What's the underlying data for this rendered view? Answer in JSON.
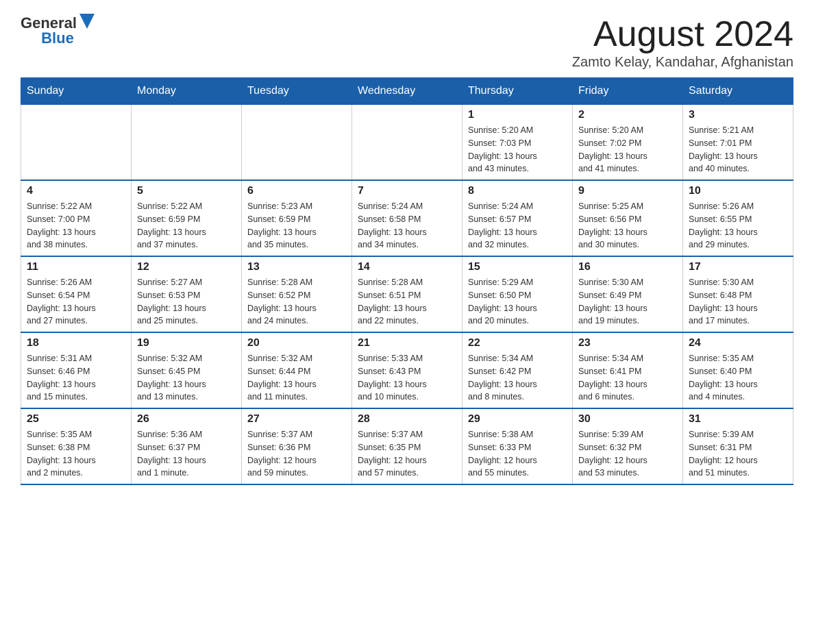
{
  "header": {
    "logo": {
      "general": "General",
      "blue": "Blue"
    },
    "month_title": "August 2024",
    "location": "Zamto Kelay, Kandahar, Afghanistan"
  },
  "days_of_week": [
    "Sunday",
    "Monday",
    "Tuesday",
    "Wednesday",
    "Thursday",
    "Friday",
    "Saturday"
  ],
  "weeks": [
    {
      "days": [
        {
          "number": "",
          "info": ""
        },
        {
          "number": "",
          "info": ""
        },
        {
          "number": "",
          "info": ""
        },
        {
          "number": "",
          "info": ""
        },
        {
          "number": "1",
          "info": "Sunrise: 5:20 AM\nSunset: 7:03 PM\nDaylight: 13 hours\nand 43 minutes."
        },
        {
          "number": "2",
          "info": "Sunrise: 5:20 AM\nSunset: 7:02 PM\nDaylight: 13 hours\nand 41 minutes."
        },
        {
          "number": "3",
          "info": "Sunrise: 5:21 AM\nSunset: 7:01 PM\nDaylight: 13 hours\nand 40 minutes."
        }
      ]
    },
    {
      "days": [
        {
          "number": "4",
          "info": "Sunrise: 5:22 AM\nSunset: 7:00 PM\nDaylight: 13 hours\nand 38 minutes."
        },
        {
          "number": "5",
          "info": "Sunrise: 5:22 AM\nSunset: 6:59 PM\nDaylight: 13 hours\nand 37 minutes."
        },
        {
          "number": "6",
          "info": "Sunrise: 5:23 AM\nSunset: 6:59 PM\nDaylight: 13 hours\nand 35 minutes."
        },
        {
          "number": "7",
          "info": "Sunrise: 5:24 AM\nSunset: 6:58 PM\nDaylight: 13 hours\nand 34 minutes."
        },
        {
          "number": "8",
          "info": "Sunrise: 5:24 AM\nSunset: 6:57 PM\nDaylight: 13 hours\nand 32 minutes."
        },
        {
          "number": "9",
          "info": "Sunrise: 5:25 AM\nSunset: 6:56 PM\nDaylight: 13 hours\nand 30 minutes."
        },
        {
          "number": "10",
          "info": "Sunrise: 5:26 AM\nSunset: 6:55 PM\nDaylight: 13 hours\nand 29 minutes."
        }
      ]
    },
    {
      "days": [
        {
          "number": "11",
          "info": "Sunrise: 5:26 AM\nSunset: 6:54 PM\nDaylight: 13 hours\nand 27 minutes."
        },
        {
          "number": "12",
          "info": "Sunrise: 5:27 AM\nSunset: 6:53 PM\nDaylight: 13 hours\nand 25 minutes."
        },
        {
          "number": "13",
          "info": "Sunrise: 5:28 AM\nSunset: 6:52 PM\nDaylight: 13 hours\nand 24 minutes."
        },
        {
          "number": "14",
          "info": "Sunrise: 5:28 AM\nSunset: 6:51 PM\nDaylight: 13 hours\nand 22 minutes."
        },
        {
          "number": "15",
          "info": "Sunrise: 5:29 AM\nSunset: 6:50 PM\nDaylight: 13 hours\nand 20 minutes."
        },
        {
          "number": "16",
          "info": "Sunrise: 5:30 AM\nSunset: 6:49 PM\nDaylight: 13 hours\nand 19 minutes."
        },
        {
          "number": "17",
          "info": "Sunrise: 5:30 AM\nSunset: 6:48 PM\nDaylight: 13 hours\nand 17 minutes."
        }
      ]
    },
    {
      "days": [
        {
          "number": "18",
          "info": "Sunrise: 5:31 AM\nSunset: 6:46 PM\nDaylight: 13 hours\nand 15 minutes."
        },
        {
          "number": "19",
          "info": "Sunrise: 5:32 AM\nSunset: 6:45 PM\nDaylight: 13 hours\nand 13 minutes."
        },
        {
          "number": "20",
          "info": "Sunrise: 5:32 AM\nSunset: 6:44 PM\nDaylight: 13 hours\nand 11 minutes."
        },
        {
          "number": "21",
          "info": "Sunrise: 5:33 AM\nSunset: 6:43 PM\nDaylight: 13 hours\nand 10 minutes."
        },
        {
          "number": "22",
          "info": "Sunrise: 5:34 AM\nSunset: 6:42 PM\nDaylight: 13 hours\nand 8 minutes."
        },
        {
          "number": "23",
          "info": "Sunrise: 5:34 AM\nSunset: 6:41 PM\nDaylight: 13 hours\nand 6 minutes."
        },
        {
          "number": "24",
          "info": "Sunrise: 5:35 AM\nSunset: 6:40 PM\nDaylight: 13 hours\nand 4 minutes."
        }
      ]
    },
    {
      "days": [
        {
          "number": "25",
          "info": "Sunrise: 5:35 AM\nSunset: 6:38 PM\nDaylight: 13 hours\nand 2 minutes."
        },
        {
          "number": "26",
          "info": "Sunrise: 5:36 AM\nSunset: 6:37 PM\nDaylight: 13 hours\nand 1 minute."
        },
        {
          "number": "27",
          "info": "Sunrise: 5:37 AM\nSunset: 6:36 PM\nDaylight: 12 hours\nand 59 minutes."
        },
        {
          "number": "28",
          "info": "Sunrise: 5:37 AM\nSunset: 6:35 PM\nDaylight: 12 hours\nand 57 minutes."
        },
        {
          "number": "29",
          "info": "Sunrise: 5:38 AM\nSunset: 6:33 PM\nDaylight: 12 hours\nand 55 minutes."
        },
        {
          "number": "30",
          "info": "Sunrise: 5:39 AM\nSunset: 6:32 PM\nDaylight: 12 hours\nand 53 minutes."
        },
        {
          "number": "31",
          "info": "Sunrise: 5:39 AM\nSunset: 6:31 PM\nDaylight: 12 hours\nand 51 minutes."
        }
      ]
    }
  ]
}
